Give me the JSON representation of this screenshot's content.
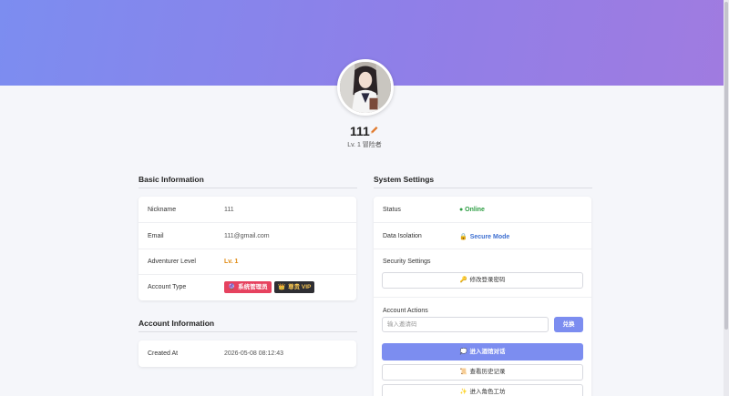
{
  "profile": {
    "username": "111",
    "level_text": "Lv. 1 冒险者"
  },
  "basic": {
    "title": "Basic Information",
    "rows": [
      {
        "label": "Nickname",
        "value": "111"
      },
      {
        "label": "Email",
        "value": "111@gmail.com"
      },
      {
        "label": "Adventurer Level",
        "value": "Lv. 1"
      },
      {
        "label": "Account Type",
        "value": ""
      }
    ],
    "badges": [
      {
        "icon": "🔮",
        "text": "系统管理员",
        "color": "#e6425f"
      },
      {
        "icon": "👑",
        "text": "尊贵 VIP",
        "color": "#2e2e33"
      }
    ]
  },
  "account": {
    "title": "Account Information",
    "rows": [
      {
        "label": "Created At",
        "value": "2026-05-08 08:12:43"
      }
    ]
  },
  "system": {
    "title": "System Settings",
    "status_label": "Status",
    "status_value": "● Online",
    "isolation_label": "Data Isolation",
    "isolation_icon": "🔒",
    "isolation_value": "Secure Mode",
    "security_label": "Security Settings",
    "change_password_icon": "🔑",
    "change_password": "修改登录密码",
    "actions_label": "Account Actions",
    "invite_placeholder": "输入邀请码",
    "redeem_button": "兑换",
    "enter_chat_icon": "💭",
    "enter_chat": "进入酒馆对话",
    "history_icon": "📜",
    "history": "查看历史记录",
    "workshop_icon": "✨",
    "workshop": "进入角色工坊"
  },
  "colors": {
    "accent": "#7c8df0",
    "online": "#2e9e44",
    "secure": "#3d6fd1",
    "level": "#e08a12"
  }
}
